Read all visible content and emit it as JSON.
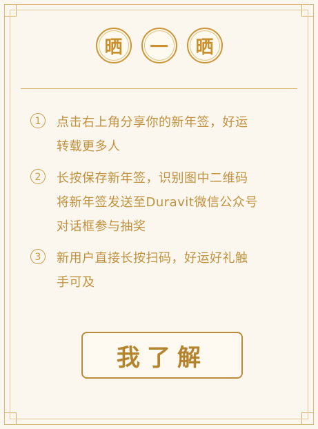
{
  "title": {
    "chars": [
      "晒",
      "一",
      "晒"
    ]
  },
  "steps": [
    {
      "num": "1",
      "text": "点击右上角分享你的新年签，好运\n转载更多人"
    },
    {
      "num": "2",
      "text": "长按保存新年签，识别图中二维码\n将新年签发送至Duravit微信公众号\n对话框参与抽奖"
    },
    {
      "num": "3",
      "text": "新用户直接长按扫码，好运好礼触\n手可及"
    }
  ],
  "button": {
    "label": "我了解"
  },
  "colors": {
    "gold": "#c9973a",
    "background": "#fbf7ef"
  }
}
